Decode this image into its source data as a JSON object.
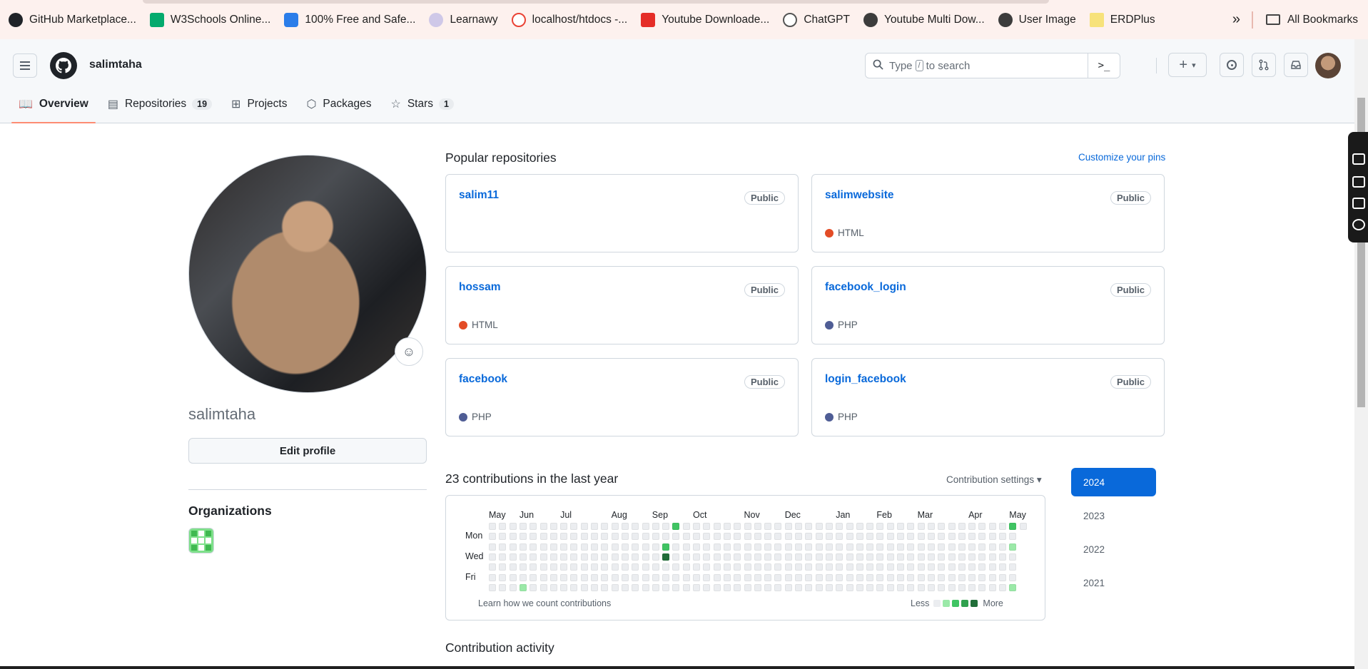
{
  "bookmarks": {
    "items": [
      {
        "label": "GitHub Marketplace...",
        "icon": "github-icon"
      },
      {
        "label": "W3Schools Online...",
        "icon": "w3schools-icon"
      },
      {
        "label": "100% Free and Safe...",
        "icon": "download-arrow-icon"
      },
      {
        "label": "Learnawy",
        "icon": "learnawy-icon"
      },
      {
        "label": "localhost/htdocs -...",
        "icon": "google-icon"
      },
      {
        "label": "Youtube Downloade...",
        "icon": "youtube-downloader-icon"
      },
      {
        "label": "ChatGPT",
        "icon": "chatgpt-icon"
      },
      {
        "label": "Youtube Multi Dow...",
        "icon": "globe-icon"
      },
      {
        "label": "User Image",
        "icon": "globe-icon"
      },
      {
        "label": "ERDPlus",
        "icon": "erdplus-icon"
      }
    ],
    "overflow": "»",
    "all_bookmarks": "All Bookmarks"
  },
  "header": {
    "username": "salimtaha",
    "search_placeholder_pre": "Type",
    "search_key": "/",
    "search_placeholder_post": "to search",
    "command_palette": ">_",
    "plus": "+",
    "caret": "▾"
  },
  "tabs": [
    {
      "label": "Overview",
      "icon": "book-icon",
      "count": ""
    },
    {
      "label": "Repositories",
      "icon": "repo-icon",
      "count": "19"
    },
    {
      "label": "Projects",
      "icon": "table-icon",
      "count": ""
    },
    {
      "label": "Packages",
      "icon": "package-icon",
      "count": ""
    },
    {
      "label": "Stars",
      "icon": "star-icon",
      "count": "1"
    }
  ],
  "profile": {
    "login": "salimtaha",
    "edit_label": "Edit profile",
    "organizations_title": "Organizations"
  },
  "popular": {
    "title": "Popular repositories",
    "customize": "Customize your pins",
    "repos": [
      {
        "name": "salim11",
        "visibility": "Public",
        "language": "",
        "lang_color": ""
      },
      {
        "name": "salimwebsite",
        "visibility": "Public",
        "language": "HTML",
        "lang_color": "#e34c26"
      },
      {
        "name": "hossam",
        "visibility": "Public",
        "language": "HTML",
        "lang_color": "#e34c26"
      },
      {
        "name": "facebook_login",
        "visibility": "Public",
        "language": "PHP",
        "lang_color": "#4F5D95"
      },
      {
        "name": "facebook",
        "visibility": "Public",
        "language": "PHP",
        "lang_color": "#4F5D95"
      },
      {
        "name": "login_facebook",
        "visibility": "Public",
        "language": "PHP",
        "lang_color": "#4F5D95"
      }
    ]
  },
  "contributions": {
    "title": "23 contributions in the last year",
    "settings": "Contribution settings ▾",
    "months": [
      "May",
      "Jun",
      "Jul",
      "Aug",
      "Sep",
      "Oct",
      "Nov",
      "Dec",
      "Jan",
      "Feb",
      "Mar",
      "Apr",
      "May"
    ],
    "month_weeks": [
      0,
      3,
      7,
      12,
      16,
      20,
      25,
      29,
      34,
      38,
      42,
      47,
      51
    ],
    "day_labels": [
      {
        "label": "Mon",
        "row": 1
      },
      {
        "label": "Wed",
        "row": 3
      },
      {
        "label": "Fri",
        "row": 5
      }
    ],
    "weeks": 53,
    "active_cells": [
      {
        "week": 3,
        "day": 6,
        "level": 1
      },
      {
        "week": 17,
        "day": 2,
        "level": 2
      },
      {
        "week": 17,
        "day": 3,
        "level": 4
      },
      {
        "week": 18,
        "day": 0,
        "level": 2
      },
      {
        "week": 51,
        "day": 0,
        "level": 2
      },
      {
        "week": 51,
        "day": 2,
        "level": 1
      },
      {
        "week": 51,
        "day": 6,
        "level": 1
      }
    ],
    "last_week_days": 1,
    "levels": [
      "#ebedf0",
      "#9be9a8",
      "#40c463",
      "#30a14e",
      "#216e39"
    ],
    "learn": "Learn how we count contributions",
    "less": "Less",
    "more": "More",
    "years": [
      "2024",
      "2023",
      "2022",
      "2021"
    ],
    "selected_year": "2024"
  },
  "activity_title": "Contribution activity"
}
